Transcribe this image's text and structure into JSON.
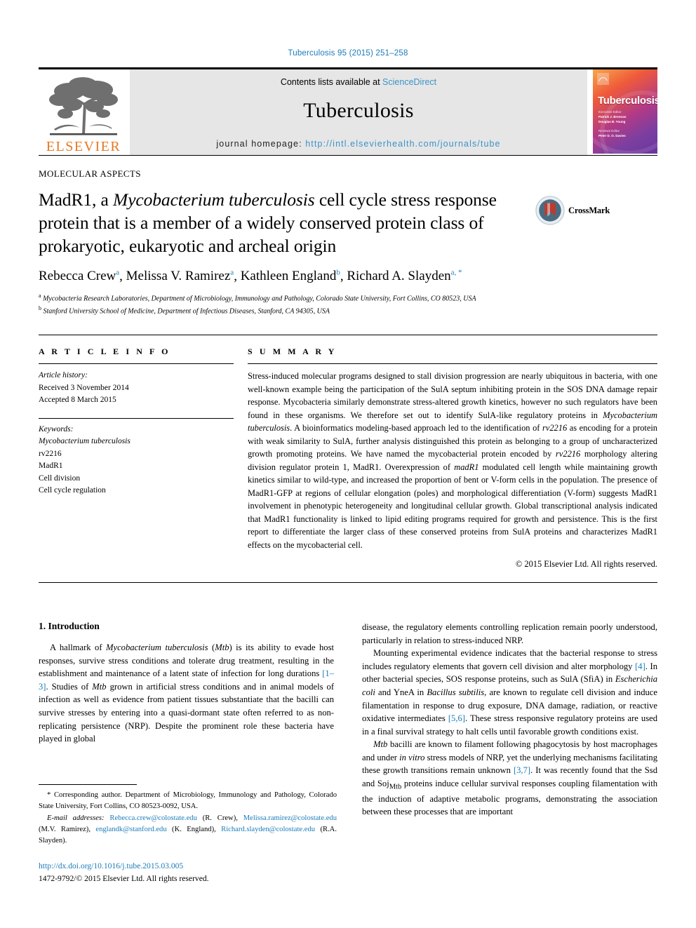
{
  "running_head": "Tuberculosis 95 (2015) 251–258",
  "masthead": {
    "publisher_name": "ELSEVIER",
    "contents_prefix": "Contents lists available at ",
    "contents_link": "ScienceDirect",
    "journal_name": "Tuberculosis",
    "homepage_label": "journal homepage:",
    "homepage_url": "http://intl.elsevierhealth.com/journals/tube",
    "cover": {
      "title": "Tuberculosis",
      "line1": "Executive Editor",
      "line2": "Patrick J. Brennan",
      "line3": "Douglas B. Young",
      "line4": "Reviews Editor",
      "line5": "Peter D. O. Davies"
    }
  },
  "article": {
    "section_label": "MOLECULAR ASPECTS",
    "title_part1": "MadR1, a ",
    "title_italic": "Mycobacterium tuberculosis",
    "title_part2": " cell cycle stress response protein that is a member of a widely conserved protein class of prokaryotic, eukaryotic and archeal origin",
    "crossmark_label": "CrossMark",
    "authors": [
      {
        "name": "Rebecca Crew",
        "sup": "a"
      },
      {
        "name": "Melissa V. Ramirez",
        "sup": "a"
      },
      {
        "name": "Kathleen England",
        "sup": "b"
      },
      {
        "name": "Richard A. Slayden",
        "sup": "a, *"
      }
    ],
    "affiliations": [
      {
        "marker": "a",
        "text": "Mycobacteria Research Laboratories, Department of Microbiology, Immunology and Pathology, Colorado State University, Fort Collins, CO 80523, USA"
      },
      {
        "marker": "b",
        "text": "Stanford University School of Medicine, Department of Infectious Diseases, Stanford, CA 94305, USA"
      }
    ]
  },
  "info": {
    "header": "A R T I C L E   I N F O",
    "history_label": "Article history:",
    "received": "Received 3 November 2014",
    "accepted": "Accepted 8 March 2015",
    "keywords_label": "Keywords:",
    "keywords": [
      "Mycobacterium tuberculosis",
      "rv2216",
      "MadR1",
      "Cell division",
      "Cell cycle regulation"
    ]
  },
  "summary": {
    "header": "S U M M A R Y",
    "text_1": "Stress-induced molecular programs designed to stall division progression are nearly ubiquitous in bacteria, with one well-known example being the participation of the SulA septum inhibiting protein in the SOS DNA damage repair response. Mycobacteria similarly demonstrate stress-altered growth kinetics, however no such regulators have been found in these organisms. We therefore set out to identify SulA-like regulatory proteins in ",
    "italic_1": "Mycobacterium tuberculosis",
    "text_2": ". A bioinformatics modeling-based approach led to the identification of ",
    "italic_2": "rv2216",
    "text_3": " as encoding for a protein with weak similarity to SulA, further analysis distinguished this protein as belonging to a group of uncharacterized growth promoting proteins. We have named the mycobacterial protein encoded by ",
    "italic_3": "rv2216",
    "text_4": " morphology altering division regulator protein 1, MadR1. Overexpression of ",
    "italic_4": "madR1",
    "text_5": " modulated cell length while maintaining growth kinetics similar to wild-type, and increased the proportion of bent or V-form cells in the population. The presence of MadR1-GFP at regions of cellular elongation (poles) and morphological differentiation (V-form) suggests MadR1 involvement in phenotypic heterogeneity and longitudinal cellular growth. Global transcriptional analysis indicated that MadR1 functionality is linked to lipid editing programs required for growth and persistence. This is the first report to differentiate the larger class of these conserved proteins from SulA proteins and characterizes MadR1 effects on the mycobacterial cell.",
    "copyright": "© 2015 Elsevier Ltd. All rights reserved."
  },
  "body": {
    "intro_heading": "1. Introduction",
    "left_p1_a": "A hallmark of ",
    "left_p1_i1": "Mycobacterium tuberculosis",
    "left_p1_b": " (",
    "left_p1_i2": "Mtb",
    "left_p1_c": ") is its ability to evade host responses, survive stress conditions and tolerate drug treatment, resulting in the establishment and maintenance of a latent state of infection for long durations ",
    "left_p1_ref1": "[1–3]",
    "left_p1_d": ". Studies of ",
    "left_p1_i3": "Mtb",
    "left_p1_e": " grown in artificial stress conditions and in animal models of infection as well as evidence from patient tissues substantiate that the bacilli can survive stresses by entering into a quasi-dormant state often referred to as non-replicating persistence (NRP). Despite the prominent role these bacteria have played in global",
    "right_p1": "disease, the regulatory elements controlling replication remain poorly understood, particularly in relation to stress-induced NRP.",
    "right_p2_a": "Mounting experimental evidence indicates that the bacterial response to stress includes regulatory elements that govern cell division and alter morphology ",
    "right_p2_ref1": "[4]",
    "right_p2_b": ". In other bacterial species, SOS response proteins, such as SulA (SfiA) in ",
    "right_p2_i1": "Escherichia coli",
    "right_p2_c": " and YneA in ",
    "right_p2_i2": "Bacillus subtilis",
    "right_p2_d": ", are known to regulate cell division and induce filamentation in response to drug exposure, DNA damage, radiation, or reactive oxidative intermediates ",
    "right_p2_ref2": "[5,6]",
    "right_p2_e": ". These stress responsive regulatory proteins are used in a final survival strategy to halt cells until favorable growth conditions exist.",
    "right_p3_i1": "Mtb",
    "right_p3_a": " bacilli are known to filament following phagocytosis by host macrophages and under ",
    "right_p3_i2": "in vitro",
    "right_p3_b": " stress models of NRP, yet the underlying mechanisms facilitating these growth transitions remain unknown ",
    "right_p3_ref1": "[3,7]",
    "right_p3_c": ". It was recently found that the Ssd and Soj",
    "right_p3_sub": "Mtb",
    "right_p3_d": " proteins induce cellular survival responses coupling filamentation with the induction of adaptive metabolic programs, demonstrating the association between these processes that are important"
  },
  "footnotes": {
    "corresponding": "* Corresponding author. Department of Microbiology, Immunology and Pathology, Colorado State University, Fort Collins, CO 80523-0092, USA.",
    "email_label": "E-mail addresses:",
    "emails": [
      {
        "addr": "Rebecca.crew@colostate.edu",
        "who": " (R. Crew), "
      },
      {
        "addr": "Melissa.ramirez@colostate.edu",
        "who": " (M.V. Ramirez), "
      },
      {
        "addr": "englandk@stanford.edu",
        "who": " (K. England), "
      },
      {
        "addr": "Richard.slayden@colostate.edu",
        "who": " (R.A. Slayden)."
      }
    ],
    "doi": "http://dx.doi.org/10.1016/j.tube.2015.03.005",
    "issn_line": "1472-9792/© 2015 Elsevier Ltd. All rights reserved."
  },
  "colors": {
    "link": "#1a7bb9",
    "elsevier_orange": "#E87722",
    "band_gray": "#e6e6e6"
  }
}
